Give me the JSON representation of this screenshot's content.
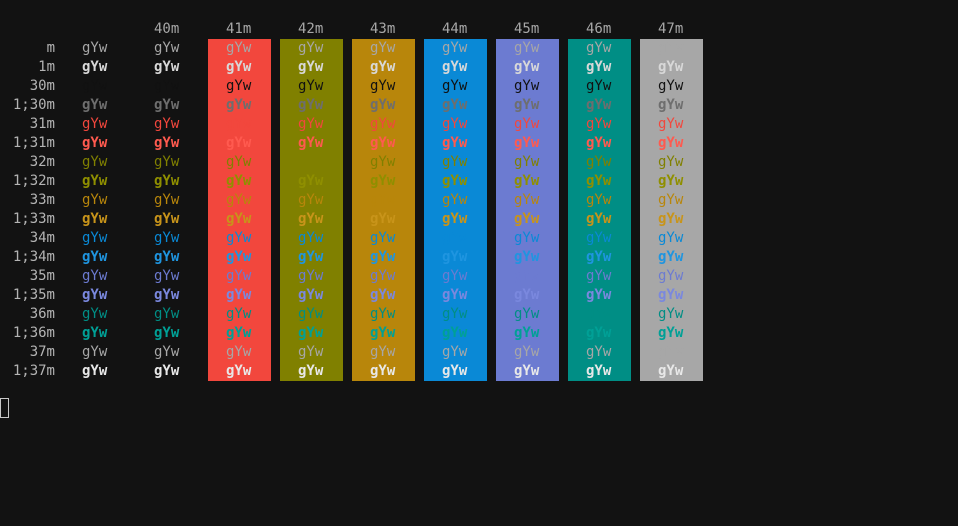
{
  "terminal": {
    "sample_text": "gYw",
    "header": [
      "40m",
      "41m",
      "42m",
      "43m",
      "44m",
      "45m",
      "46m",
      "47m"
    ],
    "rows": [
      "m",
      "1m",
      "30m",
      "1;30m",
      "31m",
      "1;31m",
      "32m",
      "1;32m",
      "33m",
      "1;33m",
      "34m",
      "1;34m",
      "35m",
      "1;35m",
      "36m",
      "1;36m",
      "37m",
      "1;37m"
    ],
    "columns": [
      "default",
      "40m",
      "41m",
      "42m",
      "43m",
      "44m",
      "45m",
      "46m",
      "47m"
    ],
    "backgrounds": {
      "40m": "#121212",
      "41m": "#f2473d",
      "42m": "#808000",
      "43m": "#b8860b",
      "44m": "#0a89d6",
      "45m": "#6c7bd1",
      "46m": "#008e85",
      "47m": "#a7a7a7"
    },
    "foregrounds": {
      "m": "#a7a7a7",
      "1m": "#d8d8d8",
      "30m": "#111111",
      "1;30m": "#6e6e6e",
      "31m": "#f2473d",
      "1;31m": "#ff5a4f",
      "32m": "#808000",
      "1;32m": "#8f8f00",
      "33m": "#b8860b",
      "1;33m": "#c8941a",
      "34m": "#0a89d6",
      "1;34m": "#1f95e0",
      "35m": "#6c7bd1",
      "1;35m": "#7a88de",
      "36m": "#008e85",
      "1;36m": "#00a096",
      "37m": "#a7a7a7",
      "1;37m": "#e8e8e8"
    },
    "cursor_icon": "block-cursor"
  }
}
